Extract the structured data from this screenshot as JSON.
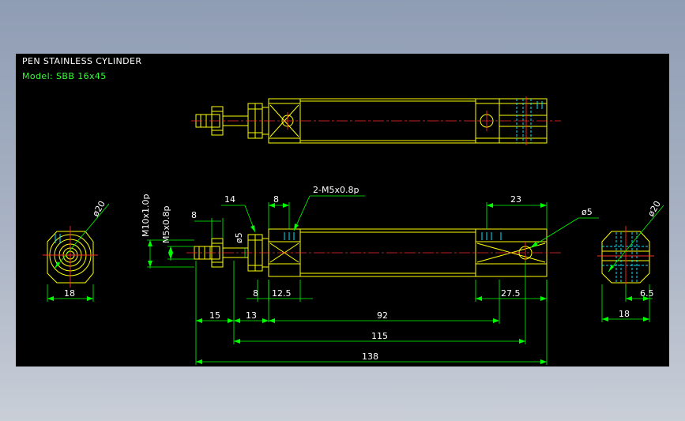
{
  "drawing": {
    "title": "PEN STAINLESS CYLINDER",
    "model": "Model: SBB 16x45"
  },
  "colors": {
    "background": "#000000",
    "outline": "#ffff00",
    "dimension": "#00ff00",
    "centerline": "#ff2a2a",
    "hidden": "#00e5ff",
    "text": "#ffffff",
    "model_text": "#33ff33"
  },
  "dimensions": {
    "left_end_dia": "ø20",
    "left_end_width": "18",
    "thread_main": "M10x1.0p",
    "thread_small": "M5x0.8p",
    "nut_width": "8",
    "hex_width": "14",
    "rod_dia": "ø5",
    "cap_length_top": "8",
    "port_callout": "2-M5x0.8p",
    "clevis_top": "23",
    "pin_dia": "ø5",
    "right_end_dia": "ø20",
    "cap_length_bottom": "8",
    "cap_offset": "12.5",
    "clevis_bottom": "27.5",
    "right_end_offset": "6.5",
    "right_end_width": "18",
    "d15": "15",
    "d13": "13",
    "d92": "92",
    "d115": "115",
    "d138": "138"
  }
}
